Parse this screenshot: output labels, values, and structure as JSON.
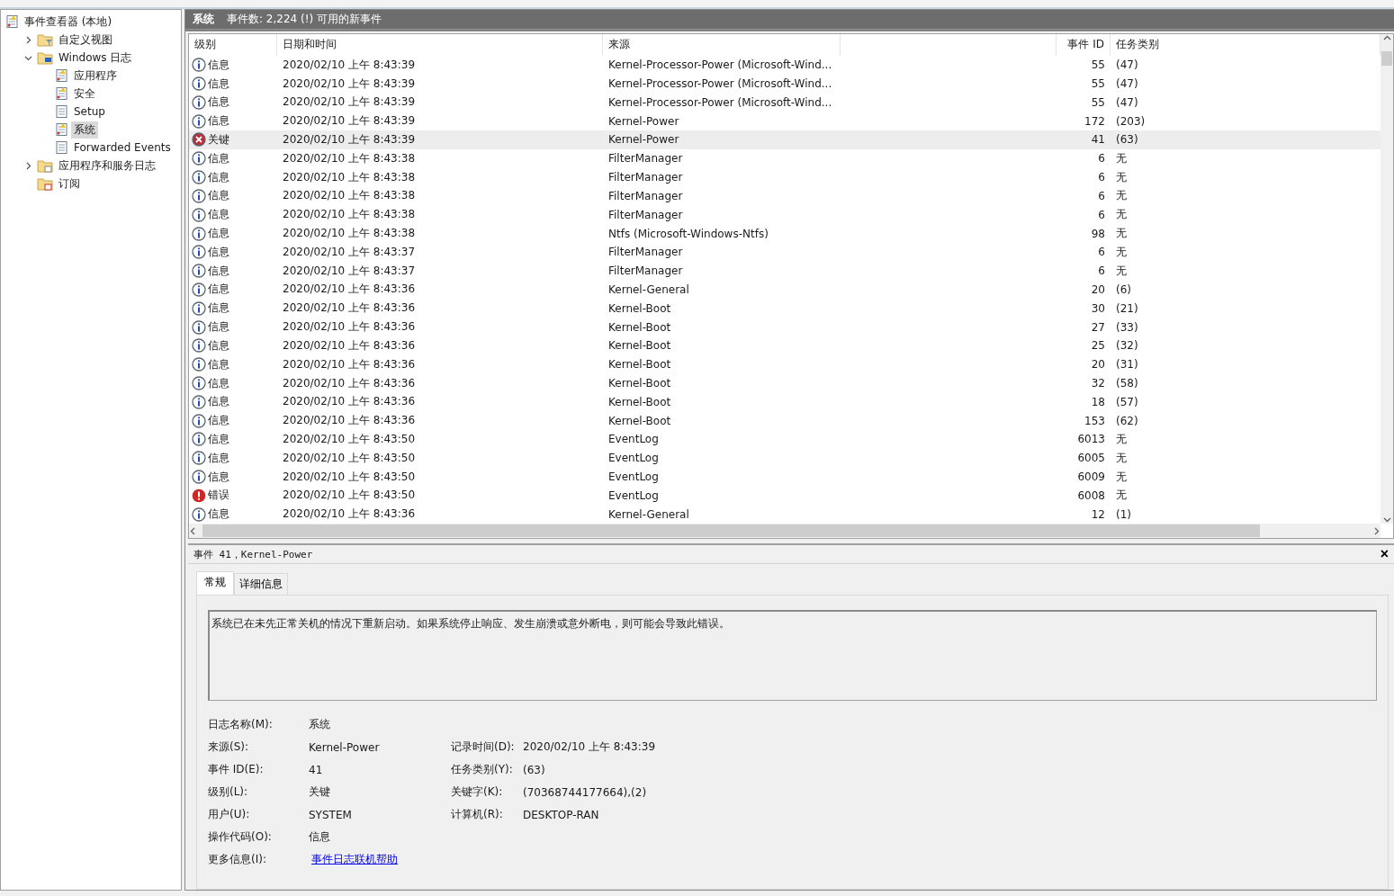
{
  "tree": [
    {
      "label": "事件查看器 (本地)",
      "kind": "viewer",
      "selected": false,
      "children": [
        {
          "label": "自定义视图",
          "kind": "filter-folder",
          "selected": false,
          "expanded": false
        },
        {
          "label": "Windows 日志",
          "kind": "pc-folder",
          "selected": false,
          "expanded": true,
          "children": [
            {
              "label": "应用程序",
              "kind": "log",
              "selected": false
            },
            {
              "label": "安全",
              "kind": "log",
              "selected": false
            },
            {
              "label": "Setup",
              "kind": "plain-log",
              "selected": false
            },
            {
              "label": "系统",
              "kind": "log",
              "selected": true
            },
            {
              "label": "Forwarded Events",
              "kind": "plain-log",
              "selected": false
            }
          ]
        },
        {
          "label": "应用程序和服务日志",
          "kind": "folder",
          "selected": false,
          "expanded": false
        },
        {
          "label": "订阅",
          "kind": "sub-folder",
          "selected": false
        }
      ]
    }
  ],
  "header": {
    "title": "系统",
    "summary": "事件数: 2,224 (!) 可用的新事件"
  },
  "table": {
    "columns": [
      "级别",
      "日期和时间",
      "来源",
      "",
      "事件 ID",
      "任务类别"
    ],
    "rows": [
      {
        "kind": "info",
        "level": "信息",
        "datetime": "2020/02/10 上午 8:43:39",
        "source": "Kernel-Processor-Power (Microsoft-Wind...",
        "event_id": "55",
        "task": "(47)",
        "selected": false
      },
      {
        "kind": "info",
        "level": "信息",
        "datetime": "2020/02/10 上午 8:43:39",
        "source": "Kernel-Processor-Power (Microsoft-Wind...",
        "event_id": "55",
        "task": "(47)",
        "selected": false
      },
      {
        "kind": "info",
        "level": "信息",
        "datetime": "2020/02/10 上午 8:43:39",
        "source": "Kernel-Processor-Power (Microsoft-Wind...",
        "event_id": "55",
        "task": "(47)",
        "selected": false
      },
      {
        "kind": "info",
        "level": "信息",
        "datetime": "2020/02/10 上午 8:43:39",
        "source": "Kernel-Power",
        "event_id": "172",
        "task": "(203)",
        "selected": false
      },
      {
        "kind": "critical",
        "level": "关键",
        "datetime": "2020/02/10 上午 8:43:39",
        "source": "Kernel-Power",
        "event_id": "41",
        "task": "(63)",
        "selected": true
      },
      {
        "kind": "info",
        "level": "信息",
        "datetime": "2020/02/10 上午 8:43:38",
        "source": "FilterManager",
        "event_id": "6",
        "task": "无",
        "selected": false
      },
      {
        "kind": "info",
        "level": "信息",
        "datetime": "2020/02/10 上午 8:43:38",
        "source": "FilterManager",
        "event_id": "6",
        "task": "无",
        "selected": false
      },
      {
        "kind": "info",
        "level": "信息",
        "datetime": "2020/02/10 上午 8:43:38",
        "source": "FilterManager",
        "event_id": "6",
        "task": "无",
        "selected": false
      },
      {
        "kind": "info",
        "level": "信息",
        "datetime": "2020/02/10 上午 8:43:38",
        "source": "FilterManager",
        "event_id": "6",
        "task": "无",
        "selected": false
      },
      {
        "kind": "info",
        "level": "信息",
        "datetime": "2020/02/10 上午 8:43:38",
        "source": "Ntfs (Microsoft-Windows-Ntfs)",
        "event_id": "98",
        "task": "无",
        "selected": false
      },
      {
        "kind": "info",
        "level": "信息",
        "datetime": "2020/02/10 上午 8:43:37",
        "source": "FilterManager",
        "event_id": "6",
        "task": "无",
        "selected": false
      },
      {
        "kind": "info",
        "level": "信息",
        "datetime": "2020/02/10 上午 8:43:37",
        "source": "FilterManager",
        "event_id": "6",
        "task": "无",
        "selected": false
      },
      {
        "kind": "info",
        "level": "信息",
        "datetime": "2020/02/10 上午 8:43:36",
        "source": "Kernel-General",
        "event_id": "20",
        "task": "(6)",
        "selected": false
      },
      {
        "kind": "info",
        "level": "信息",
        "datetime": "2020/02/10 上午 8:43:36",
        "source": "Kernel-Boot",
        "event_id": "30",
        "task": "(21)",
        "selected": false
      },
      {
        "kind": "info",
        "level": "信息",
        "datetime": "2020/02/10 上午 8:43:36",
        "source": "Kernel-Boot",
        "event_id": "27",
        "task": "(33)",
        "selected": false
      },
      {
        "kind": "info",
        "level": "信息",
        "datetime": "2020/02/10 上午 8:43:36",
        "source": "Kernel-Boot",
        "event_id": "25",
        "task": "(32)",
        "selected": false
      },
      {
        "kind": "info",
        "level": "信息",
        "datetime": "2020/02/10 上午 8:43:36",
        "source": "Kernel-Boot",
        "event_id": "20",
        "task": "(31)",
        "selected": false
      },
      {
        "kind": "info",
        "level": "信息",
        "datetime": "2020/02/10 上午 8:43:36",
        "source": "Kernel-Boot",
        "event_id": "32",
        "task": "(58)",
        "selected": false
      },
      {
        "kind": "info",
        "level": "信息",
        "datetime": "2020/02/10 上午 8:43:36",
        "source": "Kernel-Boot",
        "event_id": "18",
        "task": "(57)",
        "selected": false
      },
      {
        "kind": "info",
        "level": "信息",
        "datetime": "2020/02/10 上午 8:43:36",
        "source": "Kernel-Boot",
        "event_id": "153",
        "task": "(62)",
        "selected": false
      },
      {
        "kind": "info",
        "level": "信息",
        "datetime": "2020/02/10 上午 8:43:50",
        "source": "EventLog",
        "event_id": "6013",
        "task": "无",
        "selected": false
      },
      {
        "kind": "info",
        "level": "信息",
        "datetime": "2020/02/10 上午 8:43:50",
        "source": "EventLog",
        "event_id": "6005",
        "task": "无",
        "selected": false
      },
      {
        "kind": "info",
        "level": "信息",
        "datetime": "2020/02/10 上午 8:43:50",
        "source": "EventLog",
        "event_id": "6009",
        "task": "无",
        "selected": false
      },
      {
        "kind": "error",
        "level": "错误",
        "datetime": "2020/02/10 上午 8:43:50",
        "source": "EventLog",
        "event_id": "6008",
        "task": "无",
        "selected": false
      },
      {
        "kind": "info",
        "level": "信息",
        "datetime": "2020/02/10 上午 8:43:36",
        "source": "Kernel-General",
        "event_id": "12",
        "task": "(1)",
        "selected": false
      }
    ]
  },
  "detail": {
    "title": "事件 41，Kernel-Power",
    "close": "×",
    "tabs": [
      {
        "label": "常规",
        "selected": true
      },
      {
        "label": "详细信息",
        "selected": false
      }
    ],
    "description": "系统已在未先正常关机的情况下重新启动。如果系统停止响应、发生崩溃或意外断电，则可能会导致此错误。",
    "fields": [
      {
        "left": {
          "label": "日志名称(M):",
          "value": "系统"
        }
      },
      {
        "left": {
          "label": "来源(S):",
          "value": "Kernel-Power"
        },
        "right": {
          "label": "记录时间(D):",
          "value": "2020/02/10 上午 8:43:39"
        }
      },
      {
        "left": {
          "label": "事件 ID(E):",
          "value": "41"
        },
        "right": {
          "label": "任务类别(Y):",
          "value": "(63)"
        }
      },
      {
        "left": {
          "label": "级别(L):",
          "value": "关键"
        },
        "right": {
          "label": "关键字(K):",
          "value": "(70368744177664),(2)"
        }
      },
      {
        "left": {
          "label": "用户(U):",
          "value": "SYSTEM"
        },
        "right": {
          "label": "计算机(R):",
          "value": "DESKTOP-RAN"
        }
      },
      {
        "left": {
          "label": "操作代码(O):",
          "value": "信息"
        }
      },
      {
        "left": {
          "label": "更多信息(I):",
          "value": "事件日志联机帮助",
          "kind": "link"
        }
      }
    ]
  }
}
